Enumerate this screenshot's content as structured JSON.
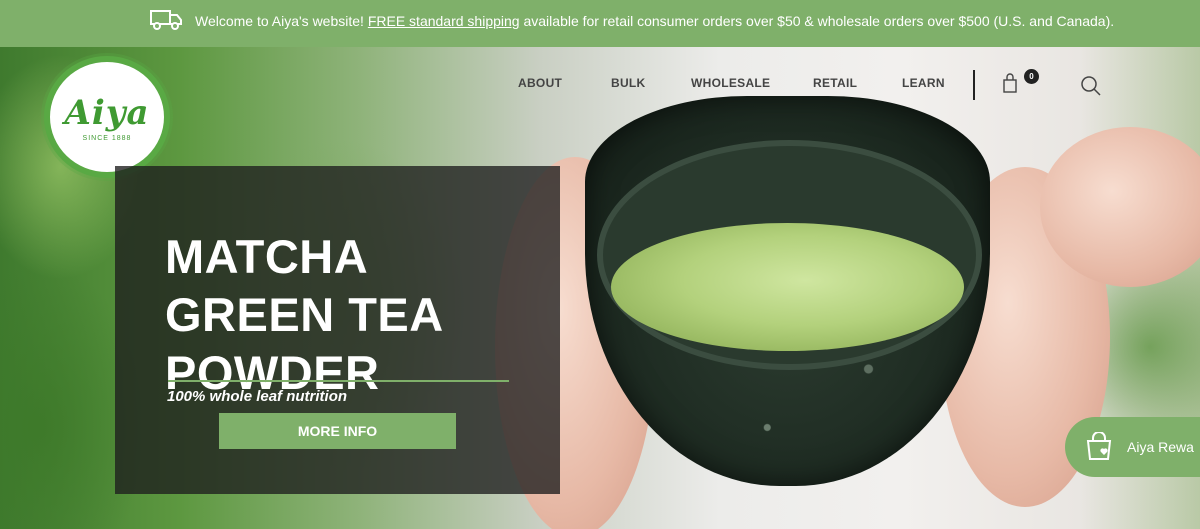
{
  "announcement": {
    "prefix": "Welcome to Aiya's website! ",
    "link": "FREE standard shipping",
    "suffix": " available for retail consumer orders over $50 & wholesale orders over $500 (U.S. and Canada).",
    "icon": "truck-icon"
  },
  "logo": {
    "brand": "Aiya",
    "since": "SINCE 1888"
  },
  "nav": {
    "items": [
      "ABOUT",
      "BULK",
      "WHOLESALE",
      "RETAIL",
      "LEARN"
    ],
    "cart_count": "0",
    "cart_icon": "shopping-bag-icon",
    "search_icon": "search-icon"
  },
  "hero": {
    "headline_1": "MATCHA",
    "headline_2": "GREEN TEA",
    "headline_3": "POWDER",
    "tagline": "100% whole leaf nutrition",
    "button": "MORE INFO"
  },
  "rewards": {
    "label": "Aiya Rewa",
    "icon": "bag-heart-icon"
  },
  "colors": {
    "accent": "#7fb06a",
    "logo_green": "#59a944",
    "panel": "#1e1e1e"
  }
}
